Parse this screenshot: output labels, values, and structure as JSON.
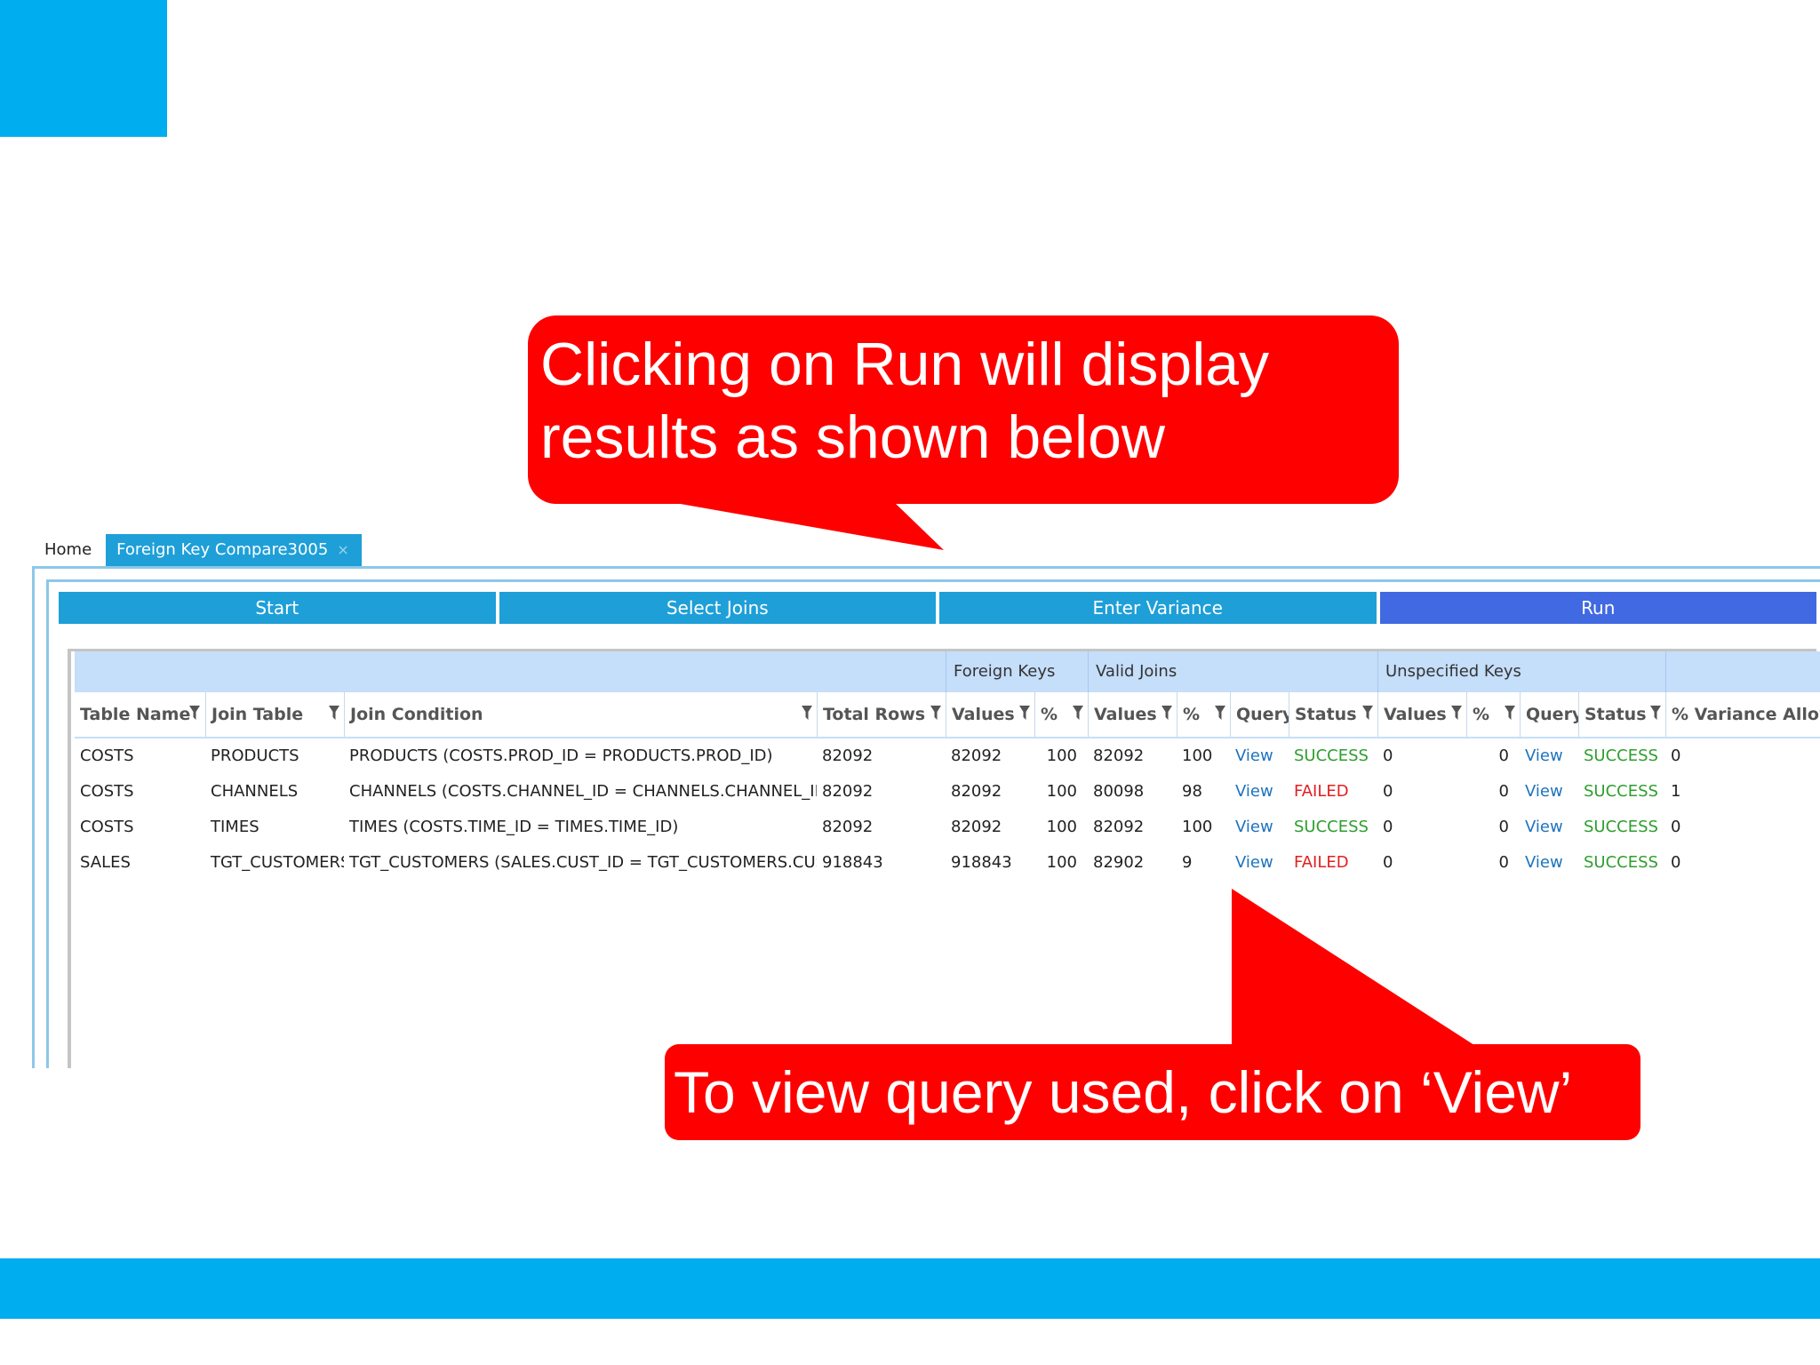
{
  "tabs": {
    "home": "Home",
    "active": "Foreign Key Compare3005",
    "close_glyph": "×"
  },
  "wizard": {
    "steps": [
      "Start",
      "Select Joins",
      "Enter Variance",
      "Run"
    ],
    "active_step": "Run"
  },
  "groups": {
    "foreign_keys": "Foreign Keys",
    "valid_joins": "Valid Joins",
    "unspecified_keys": "Unspecified Keys"
  },
  "headers": {
    "table_name": "Table Name",
    "join_table": "Join Table",
    "join_condition": "Join Condition",
    "total_rows": "Total Rows",
    "fk_values": "Values",
    "fk_pct": "%",
    "vj_values": "Values",
    "vj_pct": "%",
    "vj_query": "Query",
    "vj_status": "Status",
    "uk_values": "Values",
    "uk_pct": "%",
    "uk_query": "Query",
    "uk_status": "Status",
    "variance": "% Variance Allowed"
  },
  "rows": [
    {
      "table_name": "COSTS",
      "join_table": "PRODUCTS",
      "join_condition": "PRODUCTS (COSTS.PROD_ID = PRODUCTS.PROD_ID)",
      "total_rows": "82092",
      "fk_values": "82092",
      "fk_pct": "100",
      "vj_values": "82092",
      "vj_pct": "100",
      "vj_query": "View",
      "vj_status": "SUCCESS",
      "uk_values": "0",
      "uk_pct": "0",
      "uk_query": "View",
      "uk_status": "SUCCESS",
      "variance": "0"
    },
    {
      "table_name": "COSTS",
      "join_table": "CHANNELS",
      "join_condition": "CHANNELS (COSTS.CHANNEL_ID = CHANNELS.CHANNEL_ID)",
      "total_rows": "82092",
      "fk_values": "82092",
      "fk_pct": "100",
      "vj_values": "80098",
      "vj_pct": "98",
      "vj_query": "View",
      "vj_status": "FAILED",
      "uk_values": "0",
      "uk_pct": "0",
      "uk_query": "View",
      "uk_status": "SUCCESS",
      "variance": "1"
    },
    {
      "table_name": "COSTS",
      "join_table": "TIMES",
      "join_condition": "TIMES (COSTS.TIME_ID = TIMES.TIME_ID)",
      "total_rows": "82092",
      "fk_values": "82092",
      "fk_pct": "100",
      "vj_values": "82092",
      "vj_pct": "100",
      "vj_query": "View",
      "vj_status": "SUCCESS",
      "uk_values": "0",
      "uk_pct": "0",
      "uk_query": "View",
      "uk_status": "SUCCESS",
      "variance": "0"
    },
    {
      "table_name": "SALES",
      "join_table": "TGT_CUSTOMERS",
      "join_condition": "TGT_CUSTOMERS (SALES.CUST_ID = TGT_CUSTOMERS.CUST_ID)",
      "total_rows": "918843",
      "fk_values": "918843",
      "fk_pct": "100",
      "vj_values": "82902",
      "vj_pct": "9",
      "vj_query": "View",
      "vj_status": "FAILED",
      "uk_values": "0",
      "uk_pct": "0",
      "uk_query": "View",
      "uk_status": "SUCCESS",
      "variance": "0"
    }
  ],
  "callouts": {
    "top": {
      "line1": "Clicking on Run will display",
      "line2": "results as shown below"
    },
    "bottom": {
      "text": "To view query used, click on ‘View’"
    }
  },
  "colors": {
    "brand": "#00aeef",
    "tab_blue": "#1e9fd8",
    "run_active": "#4169e1",
    "callout_red": "#ff0000",
    "success": "#2e9e2e",
    "failed": "#e02020",
    "link": "#1e73be"
  }
}
